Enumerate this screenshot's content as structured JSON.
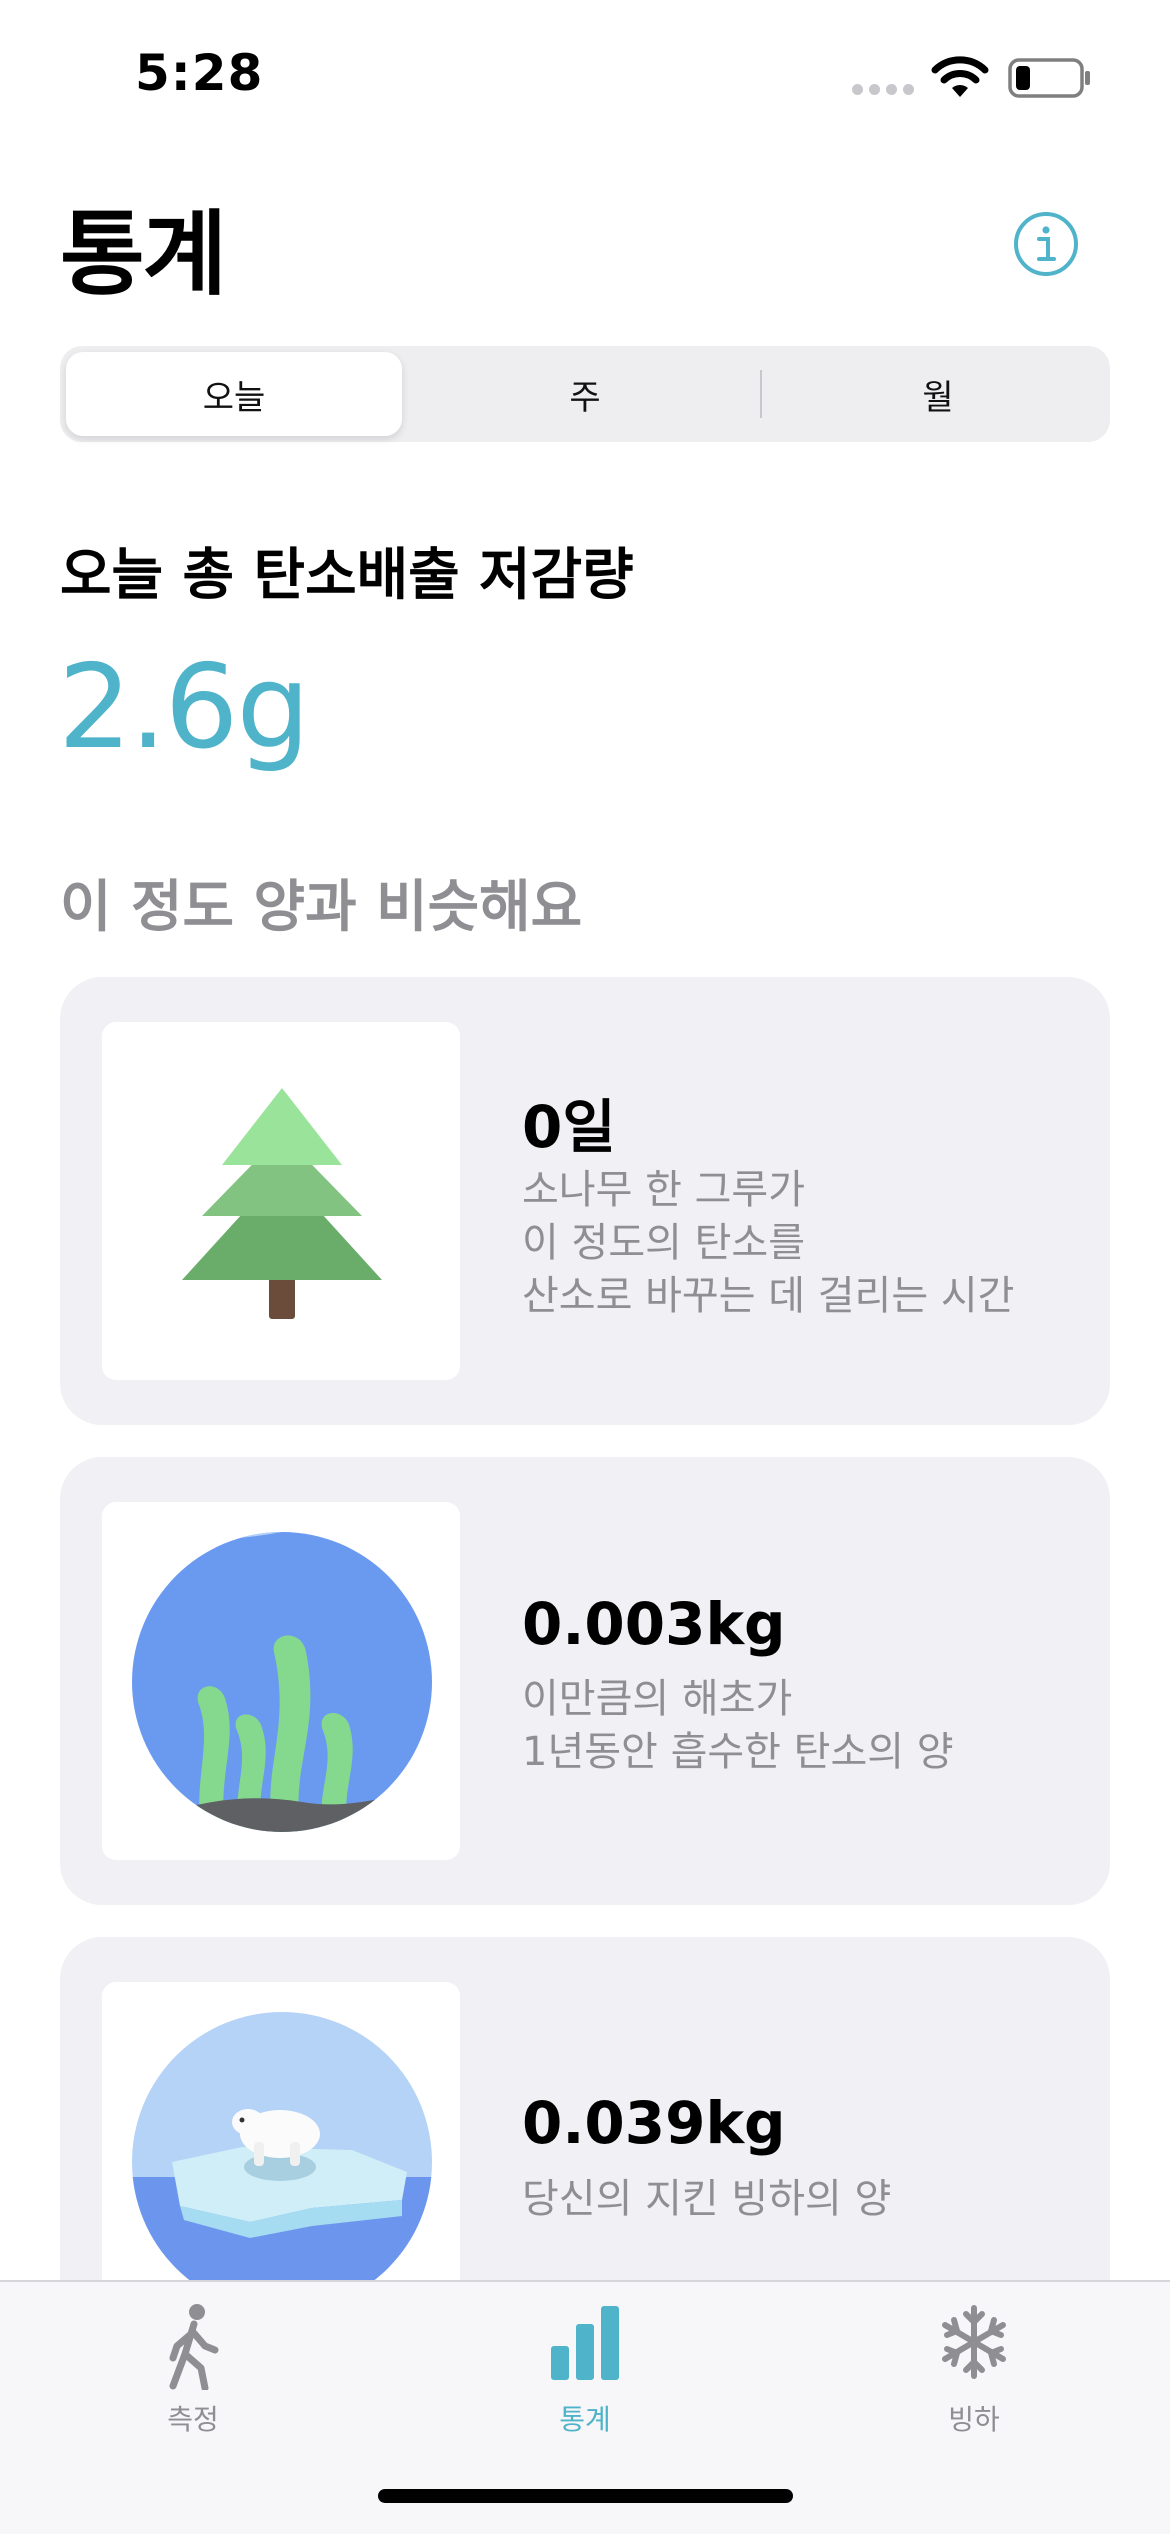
{
  "status": {
    "time": "5:28"
  },
  "header": {
    "title": "통계"
  },
  "segments": [
    {
      "label": "오늘",
      "selected": true
    },
    {
      "label": "주",
      "selected": false
    },
    {
      "label": "월",
      "selected": false
    }
  ],
  "summary": {
    "title": "오늘 총 탄소배출 저감량",
    "value": "2.6g",
    "value_color": "#4fb3c9"
  },
  "comparison": {
    "title": "이 정도 양과 비슷해요",
    "cards": [
      {
        "icon": "pine-tree-icon",
        "value": "0일",
        "description": "소나무 한 그루가\n이 정도의 탄소를\n산소로 바꾸는 데 걸리는 시간"
      },
      {
        "icon": "seaweed-icon",
        "value": "0.003kg",
        "description": "이만큼의 해초가\n1년동안 흡수한 탄소의 양"
      },
      {
        "icon": "polar-bear-icon",
        "value": "0.039kg",
        "description": "당신의 지킨 빙하의 양"
      }
    ]
  },
  "tabbar": {
    "items": [
      {
        "label": "측정",
        "icon": "walking-figure-icon",
        "active": false
      },
      {
        "label": "통계",
        "icon": "bar-chart-icon",
        "active": true
      },
      {
        "label": "빙하",
        "icon": "snowflake-icon",
        "active": false
      }
    ],
    "active_color": "#4fb3c9",
    "inactive_color": "#8e8e93"
  }
}
